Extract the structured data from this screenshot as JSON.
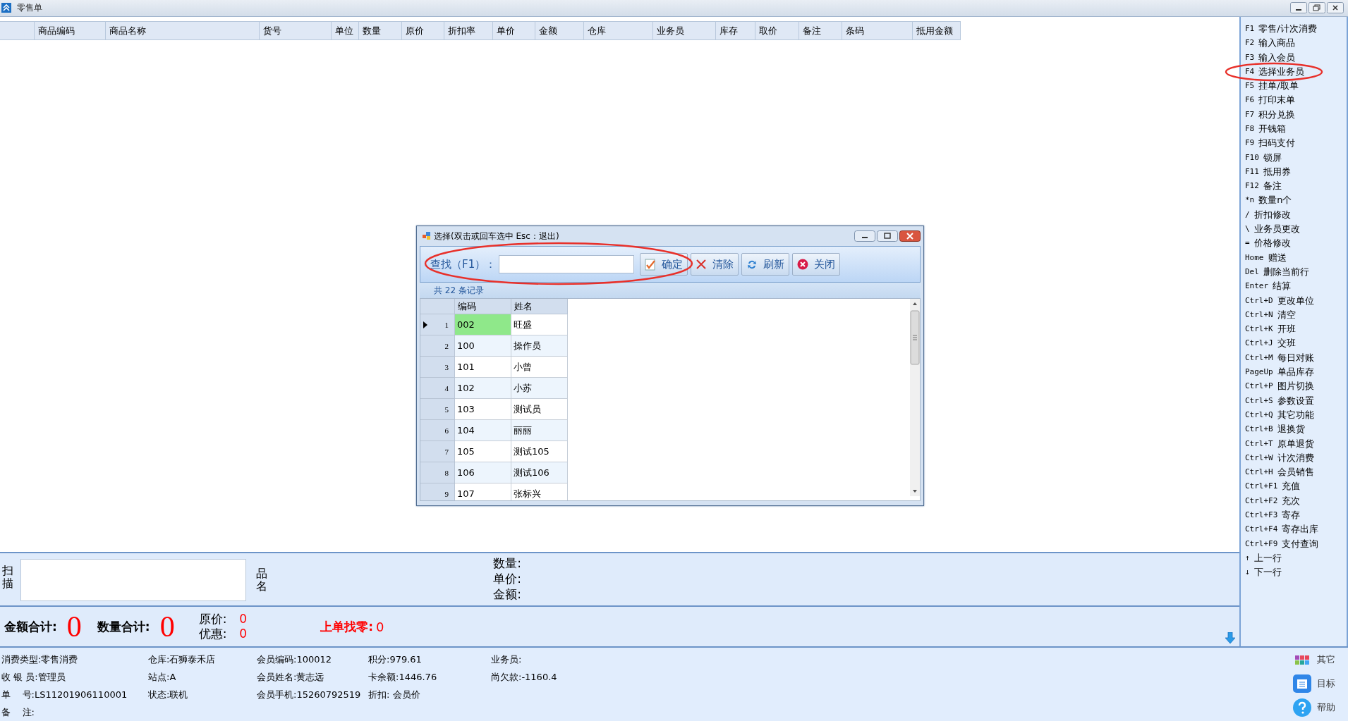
{
  "window": {
    "title": "零售单"
  },
  "table": {
    "columns": [
      "",
      "商品编码",
      "商品名称",
      "货号",
      "单位",
      "数量",
      "原价",
      "折扣率",
      "单价",
      "金额",
      "仓库",
      "业务员",
      "库存",
      "取价",
      "备注",
      "条码",
      "抵用金额"
    ]
  },
  "shortcuts": [
    {
      "key": "F1",
      "label": "零售/计次消费"
    },
    {
      "key": "F2",
      "label": "输入商品"
    },
    {
      "key": "F3",
      "label": "输入会员"
    },
    {
      "key": "F4",
      "label": "选择业务员"
    },
    {
      "key": "F5",
      "label": "挂单/取单"
    },
    {
      "key": "F6",
      "label": "打印末单"
    },
    {
      "key": "F7",
      "label": "积分兑换"
    },
    {
      "key": "F8",
      "label": "开钱箱"
    },
    {
      "key": "F9",
      "label": "扫码支付"
    },
    {
      "key": "F10",
      "label": "锁屏"
    },
    {
      "key": "F11",
      "label": "抵用券"
    },
    {
      "key": "F12",
      "label": "备注"
    },
    {
      "key": "*n",
      "label": " 数量n个"
    },
    {
      "key": "/",
      "label": "折扣修改"
    },
    {
      "key": "\\",
      "label": "业务员更改"
    },
    {
      "key": "=",
      "label": "价格修改"
    },
    {
      "key": "Home",
      "label": "赠送"
    },
    {
      "key": "Del",
      "label": "删除当前行"
    },
    {
      "key": "Enter",
      "label": "结算"
    },
    {
      "key": "Ctrl+D",
      "label": "更改单位"
    },
    {
      "key": "Ctrl+N",
      "label": "清空"
    },
    {
      "key": "Ctrl+K",
      "label": "开班"
    },
    {
      "key": "Ctrl+J",
      "label": "交班"
    },
    {
      "key": "Ctrl+M",
      "label": "每日对账"
    },
    {
      "key": "PageUp",
      "label": "单品库存"
    },
    {
      "key": "Ctrl+P",
      "label": "图片切换"
    },
    {
      "key": "Ctrl+S",
      "label": "参数设置"
    },
    {
      "key": "Ctrl+Q",
      "label": "其它功能"
    },
    {
      "key": "Ctrl+B",
      "label": "退换货"
    },
    {
      "key": "Ctrl+T",
      "label": "原单退货"
    },
    {
      "key": "Ctrl+W",
      "label": "计次消费"
    },
    {
      "key": "Ctrl+H",
      "label": "会员销售"
    },
    {
      "key": "Ctrl+F1",
      "label": "充值"
    },
    {
      "key": "Ctrl+F2",
      "label": "充次"
    },
    {
      "key": "Ctrl+F3",
      "label": "寄存"
    },
    {
      "key": "Ctrl+F4",
      "label": "寄存出库"
    },
    {
      "key": "Ctrl+F9",
      "label": "支付查询"
    },
    {
      "key": "↑",
      "label": "上一行"
    },
    {
      "key": "↓",
      "label": "下一行"
    }
  ],
  "scan": {
    "label": "扫描",
    "name_label": "品名",
    "quantity_label": "数量:",
    "price_label": "单价:",
    "amount_label": "金额:"
  },
  "totals": {
    "amount_label": "金额合计:",
    "amount": "0",
    "quantity_label": "数量合计:",
    "quantity": "0",
    "original_label": "原价:",
    "original": "0",
    "discount_label": "优惠:",
    "discount": "0",
    "change_label": "上单找零:",
    "change": "0"
  },
  "info": [
    [
      {
        "label": "消费类型:",
        "value": "零售消费"
      },
      {
        "label": "仓库:",
        "value": "石狮泰禾店"
      },
      {
        "label": "会员编码:",
        "value": "100012"
      },
      {
        "label": "积分:",
        "value": "979.61"
      },
      {
        "label": "业务员:"
      }
    ],
    [
      {
        "label": "收 银 员:",
        "value": "管理员"
      },
      {
        "label": "站点:",
        "value": "A"
      },
      {
        "label": "会员姓名:",
        "value": "黄志远"
      },
      {
        "label": "卡余额:",
        "value": "1446.76"
      },
      {
        "label": "尚欠款:",
        "value": "-1160.4"
      }
    ],
    [
      {
        "label": "单    号:",
        "value": "LS11201906110001"
      },
      {
        "label": "状态:",
        "value": "联机"
      },
      {
        "label": "会员手机:",
        "value": "15260792519"
      },
      {
        "label": "折扣: ",
        "value": "会员价"
      }
    ],
    [
      {
        "label": "备    注:"
      }
    ]
  ],
  "side_buttons": [
    {
      "kind": "apps",
      "label": "其它"
    },
    {
      "kind": "calendar",
      "label": "目标"
    },
    {
      "kind": "help",
      "label": "帮助"
    }
  ],
  "dialog": {
    "title": "选择(双击或回车选中  Esc：退出)",
    "search_label": "查找（F1）：",
    "buttons": [
      {
        "kind": "ok",
        "label": "确定"
      },
      {
        "kind": "clear",
        "label": "清除"
      },
      {
        "kind": "refresh",
        "label": "刷新"
      },
      {
        "kind": "close",
        "label": "关闭"
      }
    ],
    "count": "共 22 条记录",
    "columns": [
      "",
      "编码",
      "姓名"
    ],
    "rows": [
      {
        "n": "1",
        "code": "002",
        "name": "旺盛",
        "selected": true
      },
      {
        "n": "2",
        "code": "100",
        "name": "操作员",
        "selected": false
      },
      {
        "n": "3",
        "code": "101",
        "name": "小曾",
        "selected": false
      },
      {
        "n": "4",
        "code": "102",
        "name": "小苏",
        "selected": false
      },
      {
        "n": "5",
        "code": "103",
        "name": "测试员",
        "selected": false
      },
      {
        "n": "6",
        "code": "104",
        "name": "丽丽",
        "selected": false
      },
      {
        "n": "7",
        "code": "105",
        "name": "测试105",
        "selected": false
      },
      {
        "n": "8",
        "code": "106",
        "name": "测试106",
        "selected": false
      },
      {
        "n": "9",
        "code": "107",
        "name": "张标兴",
        "selected": false
      }
    ]
  }
}
